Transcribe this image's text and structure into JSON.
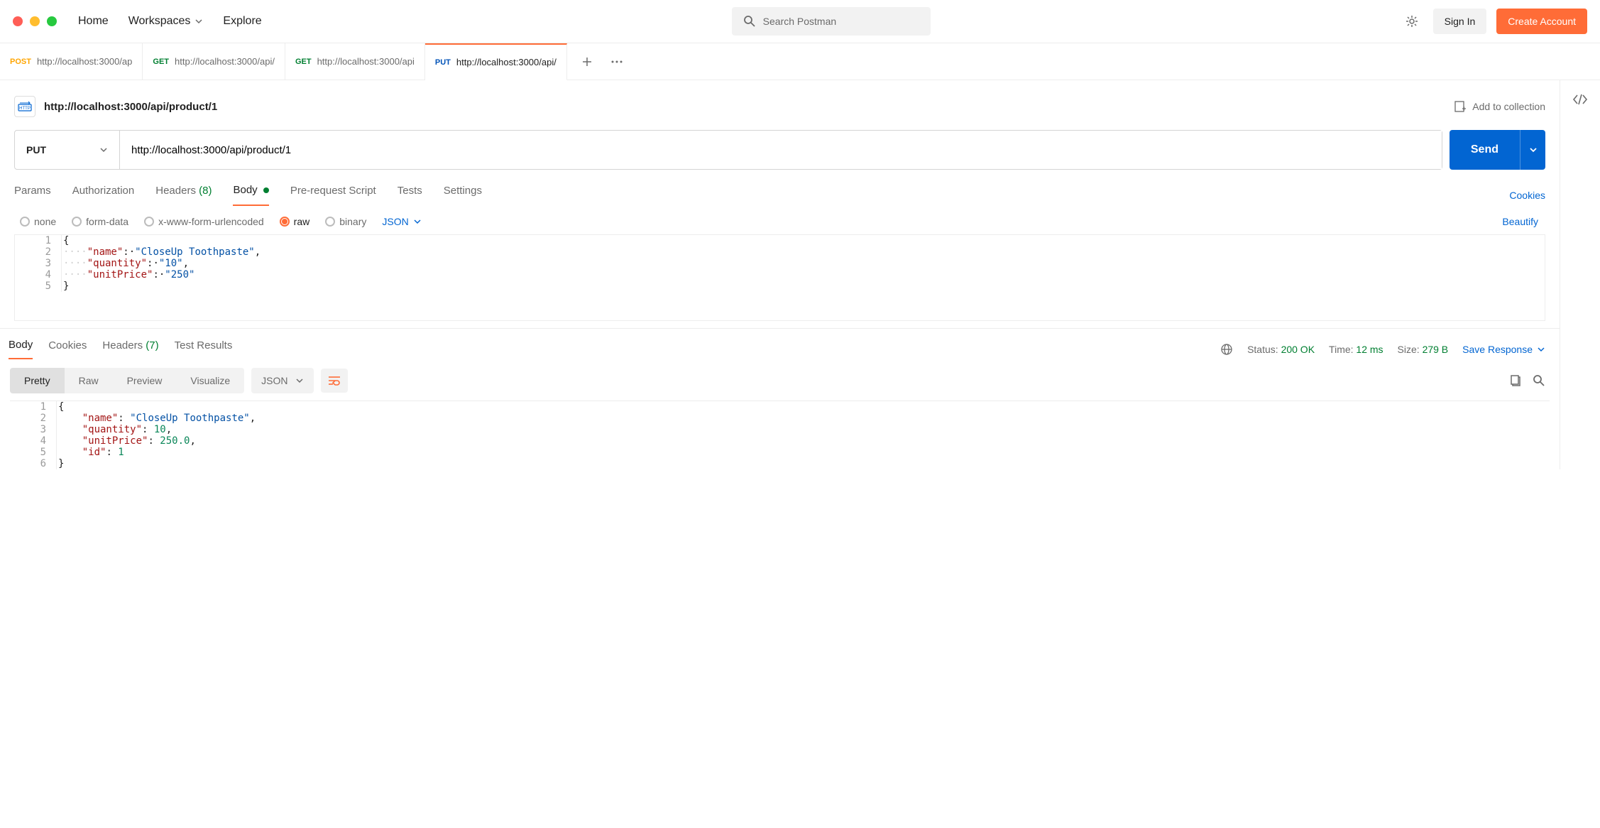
{
  "topnav": {
    "home": "Home",
    "workspaces": "Workspaces",
    "explore": "Explore"
  },
  "search": {
    "placeholder": "Search Postman"
  },
  "auth": {
    "signin": "Sign In",
    "create": "Create Account"
  },
  "tabs": [
    {
      "method": "POST",
      "label": "http://localhost:3000/ap"
    },
    {
      "method": "GET",
      "label": "http://localhost:3000/api/"
    },
    {
      "method": "GET",
      "label": "http://localhost:3000/api"
    },
    {
      "method": "PUT",
      "label": "http://localhost:3000/api/"
    }
  ],
  "active_tab_index": 3,
  "page_title": "http://localhost:3000/api/product/1",
  "add_to_collection": "Add to collection",
  "request": {
    "method": "PUT",
    "url": "http://localhost:3000/api/product/1",
    "send": "Send"
  },
  "req_subtabs": {
    "params": "Params",
    "authorization": "Authorization",
    "headers": "Headers",
    "headers_count": "(8)",
    "body": "Body",
    "prerequest": "Pre-request Script",
    "tests": "Tests",
    "settings": "Settings",
    "cookies": "Cookies"
  },
  "body_options": {
    "none": "none",
    "formdata": "form-data",
    "xwww": "x-www-form-urlencoded",
    "raw": "raw",
    "binary": "binary",
    "type": "JSON",
    "beautify": "Beautify"
  },
  "request_body": {
    "lines": [
      "1",
      "2",
      "3",
      "4",
      "5"
    ],
    "code": {
      "l2k": "\"name\"",
      "l2v": "\"CloseUp Toothpaste\"",
      "l3k": "\"quantity\"",
      "l3v": "\"10\"",
      "l4k": "\"unitPrice\"",
      "l4v": "\"250\""
    }
  },
  "response": {
    "subtabs": {
      "body": "Body",
      "cookies": "Cookies",
      "headers": "Headers",
      "headers_count": "(7)",
      "testresults": "Test Results"
    },
    "status_label": "Status:",
    "status_value": "200 OK",
    "time_label": "Time:",
    "time_value": "12 ms",
    "size_label": "Size:",
    "size_value": "279 B",
    "save": "Save Response",
    "view": {
      "pretty": "Pretty",
      "raw": "Raw",
      "preview": "Preview",
      "visualize": "Visualize",
      "type": "JSON"
    },
    "body": {
      "lines": [
        "1",
        "2",
        "3",
        "4",
        "5",
        "6"
      ],
      "code": {
        "l2k": "\"name\"",
        "l2v": "\"CloseUp Toothpaste\"",
        "l3k": "\"quantity\"",
        "l3v": "10",
        "l4k": "\"unitPrice\"",
        "l4v": "250.0",
        "l5k": "\"id\"",
        "l5v": "1"
      }
    }
  }
}
